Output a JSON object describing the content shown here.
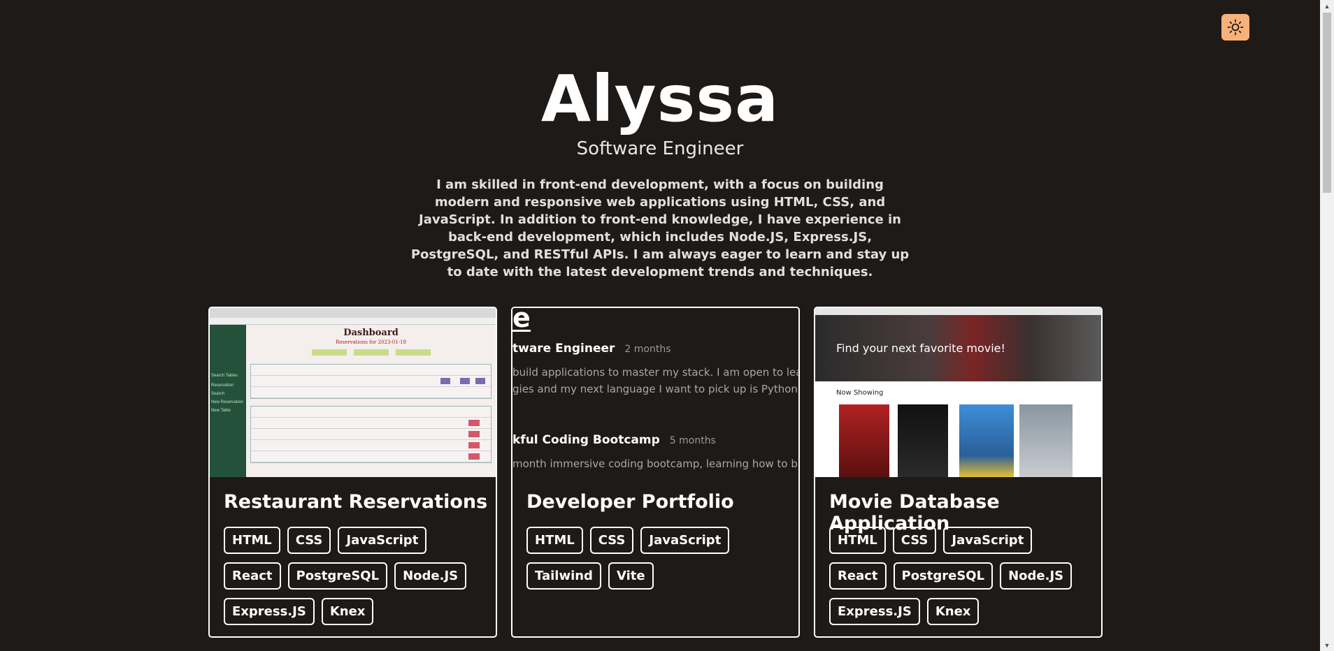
{
  "header": {
    "name": "Alyssa",
    "role": "Software Engineer",
    "bio": "I am skilled in front-end development, with a focus on building modern and responsive web applications using HTML, CSS, and JavaScript. In addition to front-end knowledge, I have experience in back-end development, which includes Node.JS, Express.JS, PostgreSQL, and RESTful APIs. I am always eager to learn and stay up to date with the latest development trends and techniques."
  },
  "theme_toggle": {
    "icon": "sun-icon",
    "color": "#f6b27a"
  },
  "projects": [
    {
      "title": "Restaurant Reservations",
      "tags": [
        "HTML",
        "CSS",
        "JavaScript",
        "React",
        "PostgreSQL",
        "Node.JS",
        "Express.JS",
        "Knex"
      ],
      "preview": {
        "heading": "Dashboard",
        "subheading": "Reservations for 2023-01-18"
      }
    },
    {
      "title": "Developer Portfolio",
      "tags": [
        "HTML",
        "CSS",
        "JavaScript",
        "Tailwind",
        "Vite"
      ],
      "preview": {
        "heading": "e",
        "job1_title": "tware Engineer",
        "job1_duration": "2 months",
        "job1_desc_line1": "build applications to master my stack. I am open to lear",
        "job1_desc_line2": "gies and my next language I want to pick up is Python",
        "job2_title": "kful Coding Bootcamp",
        "job2_duration": "5 months",
        "job2_desc_line1": "month immersive coding bootcamp, learning how to bu"
      }
    },
    {
      "title": "Movie Database Application",
      "tags": [
        "HTML",
        "CSS",
        "JavaScript",
        "React",
        "PostgreSQL",
        "Node.JS",
        "Express.JS",
        "Knex"
      ],
      "preview": {
        "heading": "Find your next favorite movie!",
        "section": "Now Showing"
      }
    }
  ]
}
